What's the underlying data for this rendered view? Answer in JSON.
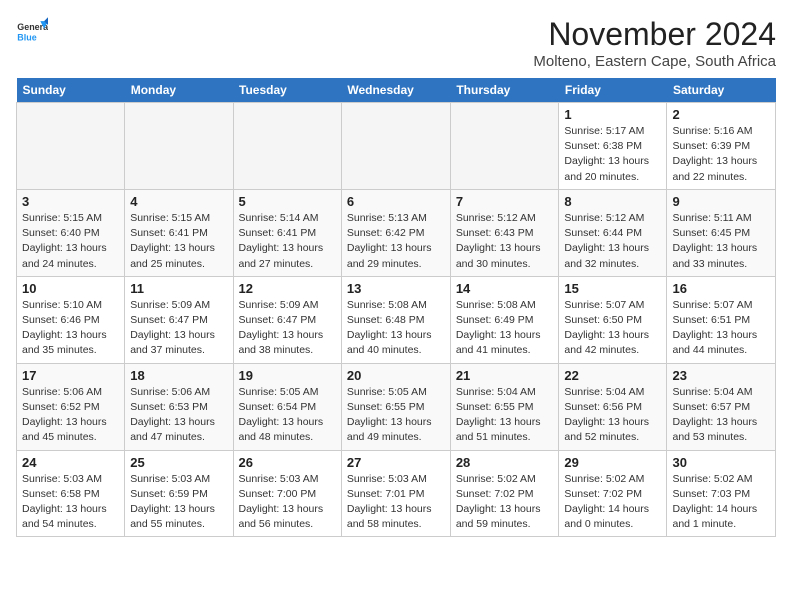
{
  "logo": {
    "text_general": "General",
    "text_blue": "Blue"
  },
  "title": "November 2024",
  "subtitle": "Molteno, Eastern Cape, South Africa",
  "days_of_week": [
    "Sunday",
    "Monday",
    "Tuesday",
    "Wednesday",
    "Thursday",
    "Friday",
    "Saturday"
  ],
  "weeks": [
    [
      {
        "day": "",
        "info": ""
      },
      {
        "day": "",
        "info": ""
      },
      {
        "day": "",
        "info": ""
      },
      {
        "day": "",
        "info": ""
      },
      {
        "day": "",
        "info": ""
      },
      {
        "day": "1",
        "info": "Sunrise: 5:17 AM\nSunset: 6:38 PM\nDaylight: 13 hours\nand 20 minutes."
      },
      {
        "day": "2",
        "info": "Sunrise: 5:16 AM\nSunset: 6:39 PM\nDaylight: 13 hours\nand 22 minutes."
      }
    ],
    [
      {
        "day": "3",
        "info": "Sunrise: 5:15 AM\nSunset: 6:40 PM\nDaylight: 13 hours\nand 24 minutes."
      },
      {
        "day": "4",
        "info": "Sunrise: 5:15 AM\nSunset: 6:41 PM\nDaylight: 13 hours\nand 25 minutes."
      },
      {
        "day": "5",
        "info": "Sunrise: 5:14 AM\nSunset: 6:41 PM\nDaylight: 13 hours\nand 27 minutes."
      },
      {
        "day": "6",
        "info": "Sunrise: 5:13 AM\nSunset: 6:42 PM\nDaylight: 13 hours\nand 29 minutes."
      },
      {
        "day": "7",
        "info": "Sunrise: 5:12 AM\nSunset: 6:43 PM\nDaylight: 13 hours\nand 30 minutes."
      },
      {
        "day": "8",
        "info": "Sunrise: 5:12 AM\nSunset: 6:44 PM\nDaylight: 13 hours\nand 32 minutes."
      },
      {
        "day": "9",
        "info": "Sunrise: 5:11 AM\nSunset: 6:45 PM\nDaylight: 13 hours\nand 33 minutes."
      }
    ],
    [
      {
        "day": "10",
        "info": "Sunrise: 5:10 AM\nSunset: 6:46 PM\nDaylight: 13 hours\nand 35 minutes."
      },
      {
        "day": "11",
        "info": "Sunrise: 5:09 AM\nSunset: 6:47 PM\nDaylight: 13 hours\nand 37 minutes."
      },
      {
        "day": "12",
        "info": "Sunrise: 5:09 AM\nSunset: 6:47 PM\nDaylight: 13 hours\nand 38 minutes."
      },
      {
        "day": "13",
        "info": "Sunrise: 5:08 AM\nSunset: 6:48 PM\nDaylight: 13 hours\nand 40 minutes."
      },
      {
        "day": "14",
        "info": "Sunrise: 5:08 AM\nSunset: 6:49 PM\nDaylight: 13 hours\nand 41 minutes."
      },
      {
        "day": "15",
        "info": "Sunrise: 5:07 AM\nSunset: 6:50 PM\nDaylight: 13 hours\nand 42 minutes."
      },
      {
        "day": "16",
        "info": "Sunrise: 5:07 AM\nSunset: 6:51 PM\nDaylight: 13 hours\nand 44 minutes."
      }
    ],
    [
      {
        "day": "17",
        "info": "Sunrise: 5:06 AM\nSunset: 6:52 PM\nDaylight: 13 hours\nand 45 minutes."
      },
      {
        "day": "18",
        "info": "Sunrise: 5:06 AM\nSunset: 6:53 PM\nDaylight: 13 hours\nand 47 minutes."
      },
      {
        "day": "19",
        "info": "Sunrise: 5:05 AM\nSunset: 6:54 PM\nDaylight: 13 hours\nand 48 minutes."
      },
      {
        "day": "20",
        "info": "Sunrise: 5:05 AM\nSunset: 6:55 PM\nDaylight: 13 hours\nand 49 minutes."
      },
      {
        "day": "21",
        "info": "Sunrise: 5:04 AM\nSunset: 6:55 PM\nDaylight: 13 hours\nand 51 minutes."
      },
      {
        "day": "22",
        "info": "Sunrise: 5:04 AM\nSunset: 6:56 PM\nDaylight: 13 hours\nand 52 minutes."
      },
      {
        "day": "23",
        "info": "Sunrise: 5:04 AM\nSunset: 6:57 PM\nDaylight: 13 hours\nand 53 minutes."
      }
    ],
    [
      {
        "day": "24",
        "info": "Sunrise: 5:03 AM\nSunset: 6:58 PM\nDaylight: 13 hours\nand 54 minutes."
      },
      {
        "day": "25",
        "info": "Sunrise: 5:03 AM\nSunset: 6:59 PM\nDaylight: 13 hours\nand 55 minutes."
      },
      {
        "day": "26",
        "info": "Sunrise: 5:03 AM\nSunset: 7:00 PM\nDaylight: 13 hours\nand 56 minutes."
      },
      {
        "day": "27",
        "info": "Sunrise: 5:03 AM\nSunset: 7:01 PM\nDaylight: 13 hours\nand 58 minutes."
      },
      {
        "day": "28",
        "info": "Sunrise: 5:02 AM\nSunset: 7:02 PM\nDaylight: 13 hours\nand 59 minutes."
      },
      {
        "day": "29",
        "info": "Sunrise: 5:02 AM\nSunset: 7:02 PM\nDaylight: 14 hours\nand 0 minutes."
      },
      {
        "day": "30",
        "info": "Sunrise: 5:02 AM\nSunset: 7:03 PM\nDaylight: 14 hours\nand 1 minute."
      }
    ]
  ]
}
